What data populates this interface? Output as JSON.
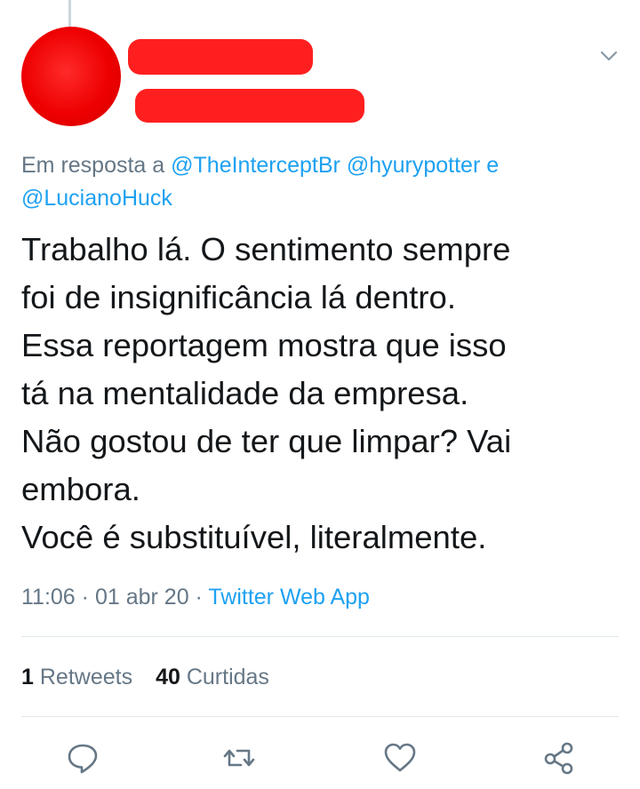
{
  "reply_context": {
    "prefix": "Em resposta a",
    "mentions": [
      "@TheInterceptBr",
      "@hyurypotter"
    ],
    "conjunction": "e",
    "last_mention": "@LucianoHuck"
  },
  "tweet": {
    "lines": [
      "Trabalho lá. O sentimento sempre",
      "foi de insignificância lá dentro.",
      "Essa reportagem mostra que isso",
      "tá na mentalidade da empresa.",
      "Não gostou de ter que limpar? Vai",
      "embora.",
      "Você é substituível, literalmente."
    ]
  },
  "meta": {
    "time": "11:06",
    "separator": "·",
    "date": "01 abr 20",
    "source": "Twitter Web App"
  },
  "stats": {
    "retweets_count": "1",
    "retweets_label": "Retweets",
    "likes_count": "40",
    "likes_label": "Curtidas"
  },
  "icons": {
    "reply": "reply-icon",
    "retweet": "retweet-icon",
    "like": "heart-icon",
    "share": "share-icon",
    "menu": "chevron-down-icon"
  },
  "colors": {
    "accent": "#1da1f2",
    "secondary_text": "#657786",
    "primary_text": "#14171a",
    "redaction": "#ff1f1f",
    "divider": "#e1e8ed"
  }
}
